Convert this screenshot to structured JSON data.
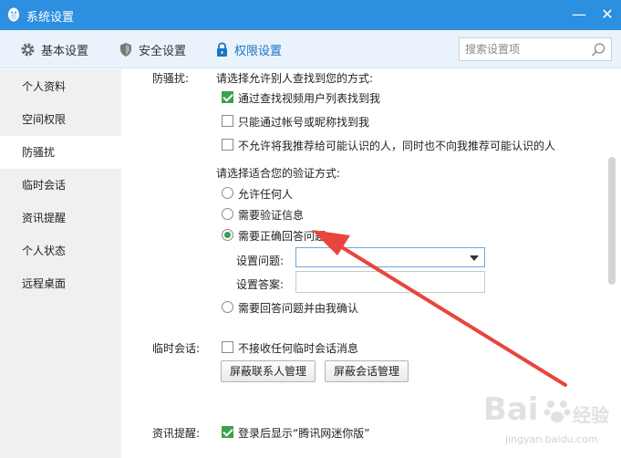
{
  "window": {
    "title": "系统设置",
    "minimize": "—",
    "close": "✕"
  },
  "toolbar": {
    "tabs": [
      {
        "label": "基本设置",
        "icon": "gear-icon"
      },
      {
        "label": "安全设置",
        "icon": "shield-icon"
      },
      {
        "label": "权限设置",
        "icon": "lock-icon"
      }
    ],
    "search_placeholder": "搜索设置项"
  },
  "sidebar": {
    "items": [
      {
        "label": "个人资料"
      },
      {
        "label": "空间权限"
      },
      {
        "label": "防骚扰",
        "active": true
      },
      {
        "label": "临时会话"
      },
      {
        "label": "资讯提醒"
      },
      {
        "label": "个人状态"
      },
      {
        "label": "远程桌面"
      }
    ]
  },
  "anti_harass": {
    "section_label": "防骚扰:",
    "find_prompt": "请选择允许别人查找到您的方式:",
    "find_options": [
      {
        "label": "通过查找视频用户列表找到我",
        "checked": true
      },
      {
        "label": "只能通过帐号或昵称找到我",
        "checked": false
      },
      {
        "label": "不允许将我推荐给可能认识的人，同时也不向我推荐可能认识的人",
        "checked": false
      }
    ],
    "verify_prompt": "请选择适合您的验证方式:",
    "verify_options": [
      {
        "label": "允许任何人",
        "selected": false
      },
      {
        "label": "需要验证信息",
        "selected": false
      },
      {
        "label": "需要正确回答问题",
        "selected": true
      }
    ],
    "question_label": "设置问题:",
    "question_value": "",
    "answer_label": "设置答案:",
    "answer_value": "",
    "verify_option_last": {
      "label": "需要回答问题并由我确认",
      "selected": false
    }
  },
  "temp_chat": {
    "section_label": "临时会话:",
    "option": {
      "label": "不接收任何临时会话消息",
      "checked": false
    },
    "btn_contacts": "屏蔽联系人管理",
    "btn_sessions": "屏蔽会话管理"
  },
  "news": {
    "section_label": "资讯提醒:",
    "option": {
      "label": "登录后显示“腾讯网迷你版”",
      "checked": true
    }
  },
  "watermark": {
    "brand": "Bai",
    "brand2": "经验",
    "url": "jingyan.baidu.com"
  },
  "colors": {
    "titlebar": "#2d8fe0",
    "accent": "#1a74c7",
    "check_green": "#3aa14f",
    "arrow_red": "#e8453c"
  }
}
